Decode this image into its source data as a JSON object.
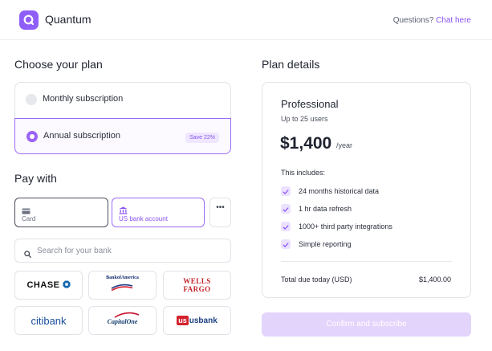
{
  "header": {
    "brand": "Quantum",
    "help_prefix": "Questions?",
    "help_link": "Chat here"
  },
  "plan_section": {
    "title": "Choose your plan",
    "options": [
      {
        "label": "Monthly subscription",
        "selected": false
      },
      {
        "label": "Annual subscription",
        "selected": true,
        "badge": "Save 22%"
      }
    ]
  },
  "pay_section": {
    "title": "Pay with",
    "methods": [
      {
        "label": "Card",
        "icon": "card-icon"
      },
      {
        "label": "US bank account",
        "icon": "bank-icon",
        "selected": true
      }
    ],
    "more_label": "•••",
    "search_placeholder": "Search for your bank",
    "banks": [
      {
        "label": "CHASE"
      },
      {
        "label": "BankofAmerica"
      },
      {
        "label": "WELLS FARGO"
      },
      {
        "label": "citibank"
      },
      {
        "label": "CapitalOne"
      },
      {
        "label": "usbank"
      }
    ]
  },
  "details": {
    "title": "Plan details",
    "tier": "Professional",
    "users": "Up to 25 users",
    "price": "$1,400",
    "period": "/year",
    "includes_label": "This includes:",
    "features": [
      "24 months historical data",
      "1 hr data refresh",
      "1000+ third party integrations",
      "Simple reporting"
    ],
    "total_label": "Total due today (USD)",
    "total_value": "$1,400.00",
    "confirm_label": "Confirm and subscribe"
  },
  "colors": {
    "accent": "#8a53f2",
    "accent_light": "#efe6ff",
    "button_disabled": "#e3d4fc"
  }
}
